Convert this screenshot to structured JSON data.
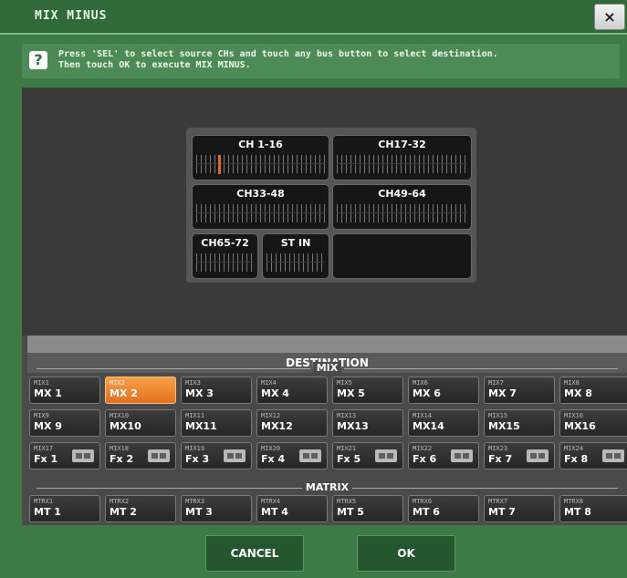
{
  "title": "MIX MINUS",
  "close_label": "×",
  "help": {
    "icon": "?",
    "text": "Press 'SEL' to select source CHs and touch any bus button to select destination.\nThen touch OK to execute MIX MINUS."
  },
  "channels": [
    "CH 1-16",
    "CH17-32",
    "CH33-48",
    "CH49-64",
    "CH65-72",
    "ST IN"
  ],
  "destination_title": "DESTINATION",
  "mix_section_label": "MIX",
  "matrix_section_label": "MATRIX",
  "mix_rows": [
    [
      {
        "small": "MIX1",
        "big": "MX 1"
      },
      {
        "small": "MIX2",
        "big": "MX 2"
      },
      {
        "small": "MIX3",
        "big": "MX 3"
      },
      {
        "small": "MIX4",
        "big": "MX 4"
      },
      {
        "small": "MIX5",
        "big": "MX 5"
      },
      {
        "small": "MIX6",
        "big": "MX 6"
      },
      {
        "small": "MIX7",
        "big": "MX 7"
      },
      {
        "small": "MIX8",
        "big": "MX 8"
      }
    ],
    [
      {
        "small": "MIX9",
        "big": "MX 9"
      },
      {
        "small": "MIX10",
        "big": "MX10"
      },
      {
        "small": "MIX11",
        "big": "MX11"
      },
      {
        "small": "MIX12",
        "big": "MX12"
      },
      {
        "small": "MIX13",
        "big": "MX13"
      },
      {
        "small": "MIX14",
        "big": "MX14"
      },
      {
        "small": "MIX15",
        "big": "MX15"
      },
      {
        "small": "MIX16",
        "big": "MX16"
      }
    ],
    [
      {
        "small": "MIX17",
        "big": "Fx 1"
      },
      {
        "small": "MIX18",
        "big": "Fx 2"
      },
      {
        "small": "MIX19",
        "big": "Fx 3"
      },
      {
        "small": "MIX20",
        "big": "Fx 4"
      },
      {
        "small": "MIX21",
        "big": "Fx 5"
      },
      {
        "small": "MIX22",
        "big": "Fx 6"
      },
      {
        "small": "MIX23",
        "big": "Fx 7"
      },
      {
        "small": "MIX24",
        "big": "Fx 8"
      }
    ]
  ],
  "selected_mix": "MIX2",
  "matrix": [
    {
      "small": "MTRX1",
      "big": "MT 1"
    },
    {
      "small": "MTRX2",
      "big": "MT 2"
    },
    {
      "small": "MTRX3",
      "big": "MT 3"
    },
    {
      "small": "MTRX4",
      "big": "MT 4"
    },
    {
      "small": "MTRX5",
      "big": "MT 5"
    },
    {
      "small": "MTRX6",
      "big": "MT 6"
    },
    {
      "small": "MTRX7",
      "big": "MT 7"
    },
    {
      "small": "MTRX8",
      "big": "MT 8"
    }
  ],
  "buttons": {
    "cancel": "CANCEL",
    "ok": "OK"
  },
  "colors": {
    "window": "#3d7a46",
    "selected": "#f2943a",
    "panel": "#3a3a3a"
  }
}
